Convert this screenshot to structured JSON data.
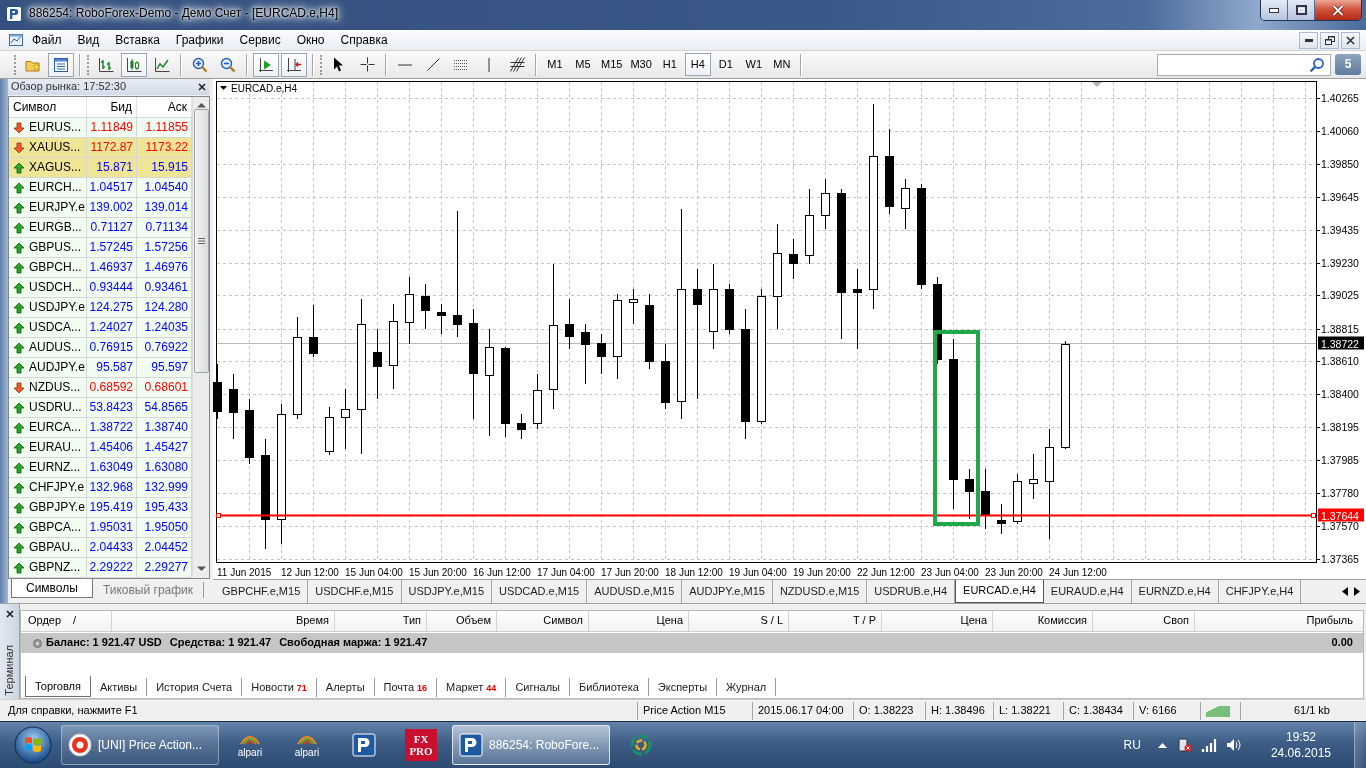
{
  "window": {
    "title": "886254: RoboForex-Demo - Демо Счет - [EURCAD.e,H4]"
  },
  "menu": [
    "Файл",
    "Вид",
    "Вставка",
    "Графики",
    "Сервис",
    "Окно",
    "Справка"
  ],
  "toolbar": {
    "tools": [
      {
        "pressed": false
      },
      {
        "pressed": true
      },
      {
        "pressed": false
      },
      {
        "pressed": true
      },
      {
        "pressed": false
      },
      {
        "pressed": false
      },
      {
        "pressed": false
      },
      {
        "pressed": true
      },
      {
        "pressed": true
      },
      {
        "pressed": false
      },
      {
        "pressed": false
      },
      {
        "pressed": false
      },
      {
        "pressed": false
      },
      {
        "pressed": false
      },
      {
        "pressed": false
      },
      {
        "pressed": false
      }
    ],
    "timeframes": [
      {
        "label": "M1",
        "selected": false
      },
      {
        "label": "M5",
        "selected": false
      },
      {
        "label": "M15",
        "selected": false
      },
      {
        "label": "M30",
        "selected": false
      },
      {
        "label": "H1",
        "selected": false
      },
      {
        "label": "H4",
        "selected": true
      },
      {
        "label": "D1",
        "selected": false
      },
      {
        "label": "W1",
        "selected": false
      },
      {
        "label": "MN",
        "selected": false
      }
    ],
    "notifications": "5"
  },
  "market_watch": {
    "title": "Обзор рынка: 17:52:30",
    "columns": [
      "Символ",
      "Бид",
      "Аск"
    ],
    "rows": [
      {
        "symbol": "EURUS...",
        "bid": "1.11849",
        "ask": "1.11855",
        "rising": false,
        "selected": false
      },
      {
        "symbol": "XAUUS...",
        "bid": "1172.87",
        "ask": "1173.22",
        "rising": false,
        "selected": true
      },
      {
        "symbol": "XAGUS...",
        "bid": "15.871",
        "ask": "15.915",
        "rising": true,
        "selected": true
      },
      {
        "symbol": "EURCH...",
        "bid": "1.04517",
        "ask": "1.04540",
        "rising": true,
        "selected": false
      },
      {
        "symbol": "EURJPY.e",
        "bid": "139.002",
        "ask": "139.014",
        "rising": true,
        "selected": false
      },
      {
        "symbol": "EURGB...",
        "bid": "0.71127",
        "ask": "0.71134",
        "rising": true,
        "selected": false
      },
      {
        "symbol": "GBPUS...",
        "bid": "1.57245",
        "ask": "1.57256",
        "rising": true,
        "selected": false
      },
      {
        "symbol": "GBPCH...",
        "bid": "1.46937",
        "ask": "1.46976",
        "rising": true,
        "selected": false
      },
      {
        "symbol": "USDCH...",
        "bid": "0.93444",
        "ask": "0.93461",
        "rising": true,
        "selected": false
      },
      {
        "symbol": "USDJPY.e",
        "bid": "124.275",
        "ask": "124.280",
        "rising": true,
        "selected": false
      },
      {
        "symbol": "USDCA...",
        "bid": "1.24027",
        "ask": "1.24035",
        "rising": true,
        "selected": false
      },
      {
        "symbol": "AUDUS...",
        "bid": "0.76915",
        "ask": "0.76922",
        "rising": true,
        "selected": false
      },
      {
        "symbol": "AUDJPY.e",
        "bid": "95.587",
        "ask": "95.597",
        "rising": true,
        "selected": false
      },
      {
        "symbol": "NZDUS...",
        "bid": "0.68592",
        "ask": "0.68601",
        "rising": false,
        "selected": false
      },
      {
        "symbol": "USDRU...",
        "bid": "53.8423",
        "ask": "54.8565",
        "rising": true,
        "selected": false
      },
      {
        "symbol": "EURCA...",
        "bid": "1.38722",
        "ask": "1.38740",
        "rising": true,
        "selected": false
      },
      {
        "symbol": "EURAU...",
        "bid": "1.45406",
        "ask": "1.45427",
        "rising": true,
        "selected": false
      },
      {
        "symbol": "EURNZ...",
        "bid": "1.63049",
        "ask": "1.63080",
        "rising": true,
        "selected": false
      },
      {
        "symbol": "CHFJPY.e",
        "bid": "132.968",
        "ask": "132.999",
        "rising": true,
        "selected": false
      },
      {
        "symbol": "GBPJPY.e",
        "bid": "195.419",
        "ask": "195.433",
        "rising": true,
        "selected": false
      },
      {
        "symbol": "GBPCA...",
        "bid": "1.95031",
        "ask": "1.95050",
        "rising": true,
        "selected": false
      },
      {
        "symbol": "GBPAU...",
        "bid": "2.04433",
        "ask": "2.04452",
        "rising": true,
        "selected": false
      },
      {
        "symbol": "GBPNZ...",
        "bid": "2.29222",
        "ask": "2.29277",
        "rising": true,
        "selected": false
      }
    ],
    "tabs": [
      {
        "label": "Символы",
        "selected": true
      },
      {
        "label": "Тиковый график",
        "selected": false
      }
    ]
  },
  "chart": {
    "symbol": "EURCAD.e,H4",
    "price_labels": [
      "1.40265",
      "1.40060",
      "1.39850",
      "1.39645",
      "1.39435",
      "1.39230",
      "1.39025",
      "1.38815",
      "1.38610",
      "1.38400",
      "1.38195",
      "1.37985",
      "1.37780",
      "1.37570",
      "1.37365"
    ],
    "time_labels": [
      "11 Jun 2015",
      "12 Jun 12:00",
      "15 Jun 04:00",
      "15 Jun 20:00",
      "16 Jun 12:00",
      "17 Jun 04:00",
      "17 Jun 20:00",
      "18 Jun 12:00",
      "19 Jun 04:00",
      "19 Jun 20:00",
      "22 Jun 12:00",
      "23 Jun 04:00",
      "23 Jun 20:00",
      "24 Jun 12:00"
    ],
    "bid_price": "1.38722",
    "line_price": "1.37644"
  },
  "chart_tabs": [
    {
      "label": "GBPCHF.e,M15",
      "selected": false
    },
    {
      "label": "USDCHF.e,M15",
      "selected": false
    },
    {
      "label": "USDJPY.e,M15",
      "selected": false
    },
    {
      "label": "USDCAD.e,M15",
      "selected": false
    },
    {
      "label": "AUDUSD.e,M15",
      "selected": false
    },
    {
      "label": "AUDJPY.e,M15",
      "selected": false
    },
    {
      "label": "NZDUSD.e,M15",
      "selected": false
    },
    {
      "label": "USDRUB.e,H4",
      "selected": false
    },
    {
      "label": "EURCAD.e,H4",
      "selected": true
    },
    {
      "label": "EURAUD.e,H4",
      "selected": false
    },
    {
      "label": "EURNZD.e,H4",
      "selected": false
    },
    {
      "label": "CHFJPY.e,H4",
      "selected": false
    }
  ],
  "terminal": {
    "side_label": "Терминал",
    "columns": [
      "Ордер",
      "Время",
      "Тип",
      "Объем",
      "Символ",
      "Цена",
      "S / L",
      "T / P",
      "Цена",
      "Комиссия",
      "Своп",
      "Прибыль"
    ],
    "sort_mark": "/",
    "balance": [
      "Баланс: 1 921.47 USD",
      "Средства: 1 921.47",
      "Свободная маржа: 1 921.47"
    ],
    "profit": "0.00",
    "tabs": [
      {
        "label": "Торговля",
        "selected": true
      },
      {
        "label": "Активы",
        "selected": false
      },
      {
        "label": "История Счета",
        "selected": false
      },
      {
        "label": "Новости",
        "badge": "71",
        "selected": false
      },
      {
        "label": "Алерты",
        "selected": false
      },
      {
        "label": "Почта",
        "badge": "16",
        "selected": false
      },
      {
        "label": "Маркет",
        "badge": "44",
        "selected": false
      },
      {
        "label": "Сигналы",
        "selected": false
      },
      {
        "label": "Библиотека",
        "selected": false
      },
      {
        "label": "Эксперты",
        "selected": false
      },
      {
        "label": "Журнал",
        "selected": false
      }
    ]
  },
  "status_bar": {
    "help": "Для справки, нажмите F1",
    "fields": [
      "Price Action M15",
      "2015.06.17 04:00",
      "O: 1.38223",
      "H: 1.38496",
      "L: 1.38221",
      "C: 1.38434",
      "V: 6166"
    ],
    "traffic": "61/1 kb"
  },
  "taskbar": {
    "buttons": [
      {
        "kind": "window",
        "label": "[UNI] Price Action...",
        "active": false
      },
      {
        "kind": "pinned",
        "label": "alpari",
        "active": false
      },
      {
        "kind": "pinned",
        "label": "alpari",
        "active": false
      },
      {
        "kind": "pinned",
        "active": false
      },
      {
        "kind": "pinned",
        "label": "FX PRO",
        "active": false
      },
      {
        "kind": "window",
        "label": "886254: RoboFore...",
        "active": true
      },
      {
        "kind": "pinned",
        "active": false
      }
    ],
    "language": "RU",
    "time": "19:52",
    "date": "24.06.2015"
  }
}
